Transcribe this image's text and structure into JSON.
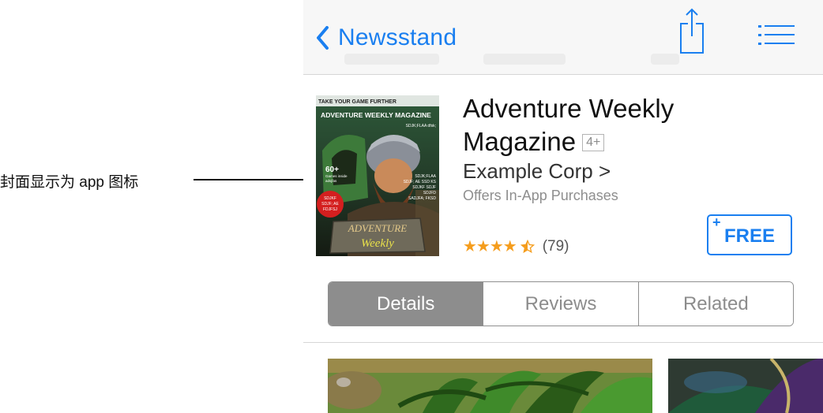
{
  "annotation": {
    "text": "封面显示为 app 图标"
  },
  "navbar": {
    "back_label": "Newsstand"
  },
  "cover": {
    "tagline": "TAKE YOUR GAME FURTHER",
    "masthead": "ADVENTURE WEEKLY MAGAZINE",
    "top_note": "SDJK;FLAA dfsk;",
    "games_count": "60+",
    "games_text_1": "Games inside",
    "games_text_2": "adsjfas",
    "right_lines": [
      "SDJK;FLAA",
      "SDJF; AE  SSD KS",
      "SDJKF SDJF",
      "SDJFD",
      "SADJFA;  FKSD"
    ],
    "badge_lines": [
      "SDJKF",
      "SDJF; AE",
      "FDJFSJ"
    ],
    "logo_line_1": "ADVENTURE",
    "logo_line_2": "Weekly"
  },
  "app": {
    "title_line_1": "Adventure Weekly",
    "title_line_2": "Magazine",
    "age_rating": "4+",
    "developer": "Example Corp >",
    "in_app_note": "Offers In-App Purchases",
    "stars": "★★★★",
    "rating_value": 4.5,
    "rating_count": "(79)",
    "price_plus": "+",
    "price_label": "FREE"
  },
  "tabs": [
    {
      "label": "Details",
      "active": true
    },
    {
      "label": "Reviews",
      "active": false
    },
    {
      "label": "Related",
      "active": false
    }
  ],
  "colors": {
    "accent": "#1a7ff0",
    "star": "#f59d1d",
    "segment_active": "#8d8d8d"
  }
}
